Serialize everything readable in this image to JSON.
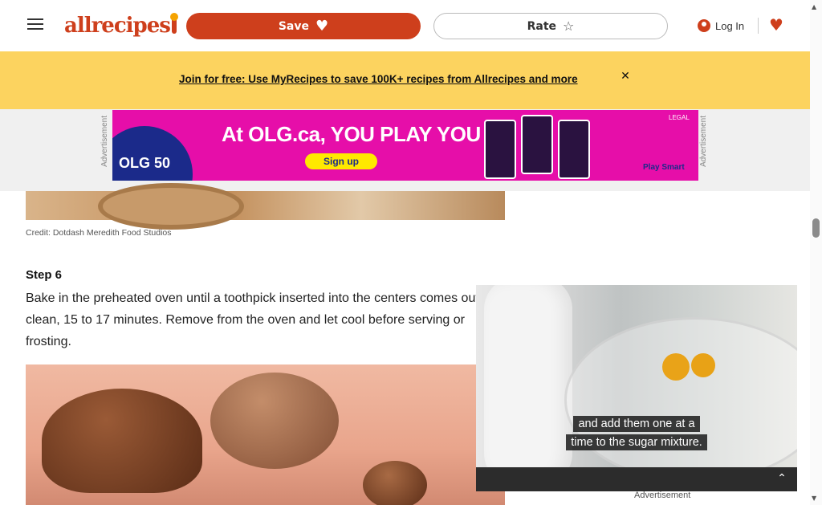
{
  "header": {
    "logo_text": "allrecipes",
    "save_label": "Save",
    "rate_label": "Rate",
    "login_label": "Log In"
  },
  "promo": {
    "link_text": "Join for free: Use MyRecipes to save 100K+ recipes from Allrecipes and more",
    "close_icon": "close-icon"
  },
  "ad": {
    "side_label": "Advertisement",
    "headline": "At OLG.ca, YOU PLAY YOU",
    "cta": "Sign up",
    "brand": "OLG 50",
    "footer": "Play Smart",
    "legal": "LEGAL"
  },
  "content": {
    "credit": "Credit: Dotdash Meredith Food Studios",
    "step_title": "Step 6",
    "step_text": "Bake in the preheated oven until a toothpick inserted into the centers comes out clean, 15 to 17 minutes. Remove from the oven and let cool before serving or frosting."
  },
  "video": {
    "caption_line1": "and add them one at a",
    "caption_line2": "time to the sugar mixture.",
    "bottom_label": "Advertisement"
  },
  "colors": {
    "brand": "#ce3f1c",
    "promo_bg": "#fcd35f",
    "ad_bg": "#e60ea9"
  }
}
